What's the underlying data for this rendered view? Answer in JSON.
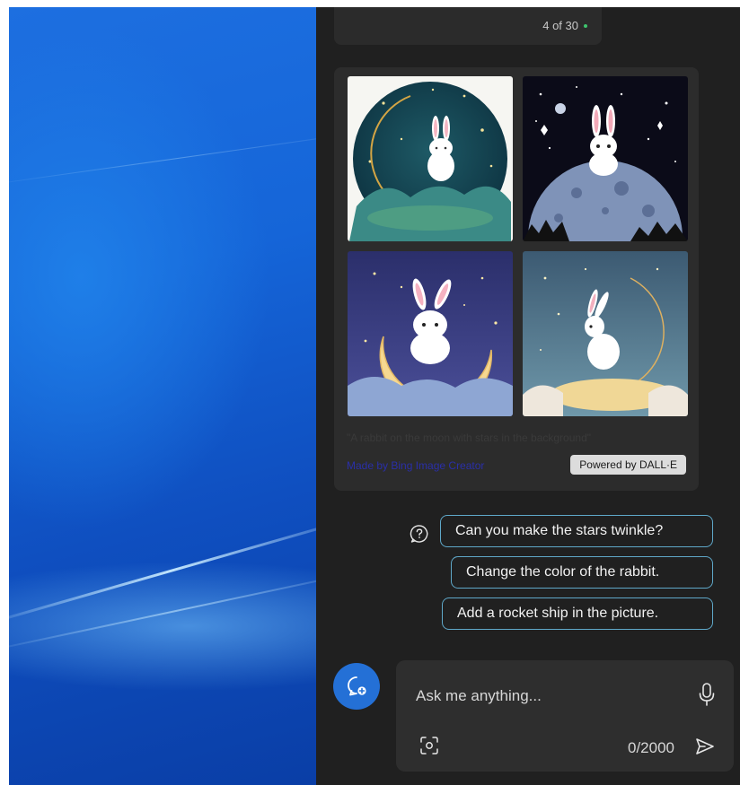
{
  "panel": {
    "pager_text": "4 of 30",
    "image_card": {
      "images": [
        {
          "alt": "Rabbit sitting on crescent moon, starry teal background"
        },
        {
          "alt": "Rabbit sitting on a round moon, dark starry sky"
        },
        {
          "alt": "Rabbit sitting on a yellow crescent moon in purple sky"
        },
        {
          "alt": "Rabbit on a crescent moon over clouds"
        }
      ],
      "caption": "\"A rabbit on the moon with stars in the background\"",
      "made_by": "Made by Bing Image Creator",
      "powered_by": "Powered by DALL·E"
    },
    "suggestions": [
      "Can you make the stars twinkle?",
      "Change the color of the rabbit.",
      "Add a rocket ship in the picture."
    ],
    "composer": {
      "placeholder": "Ask me anything...",
      "char_count": "0/2000"
    }
  },
  "colors": {
    "panel_bg": "#202020",
    "accent": "#2470d6",
    "chip_border": "#5fa8c9"
  }
}
